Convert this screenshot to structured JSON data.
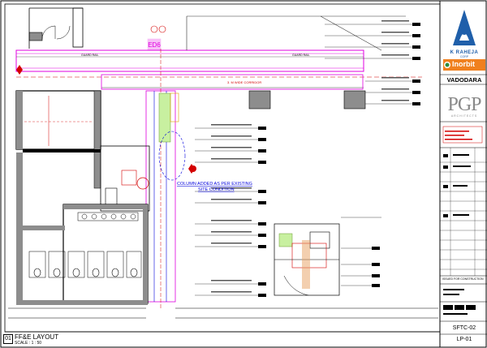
{
  "drawing": {
    "title": "FF&E LAYOUT",
    "scale": "SCALE : 1 : 50",
    "view_number": "01",
    "tag_ed": "ED6",
    "annotation_column": "COLUMN ADDED AS PER EXISTING",
    "annotation_site": "SITE CONDITION",
    "guard_rail": "GUARD RAIL",
    "corridor": "3. M WIDE CORRIDOR"
  },
  "title_block": {
    "client": "K RAHEJA",
    "client_sub": "CORP",
    "brand": "Inorbit",
    "city": "VADODARA",
    "architect": "PGP",
    "architect_sub": "ARCHITECTS",
    "status": "ISSUED FOR CONSTRUCTION",
    "sheet_code": "SFTC-02",
    "sheet_no": "LP-01"
  },
  "colors": {
    "client_blue": "#1f5faa",
    "brand_orange": "#f0801e",
    "brand_green": "#2e8b3a",
    "magenta": "#e000e0",
    "red": "#d40000",
    "grey_fill": "#8d8d8d",
    "blue_line": "#0000dd"
  }
}
